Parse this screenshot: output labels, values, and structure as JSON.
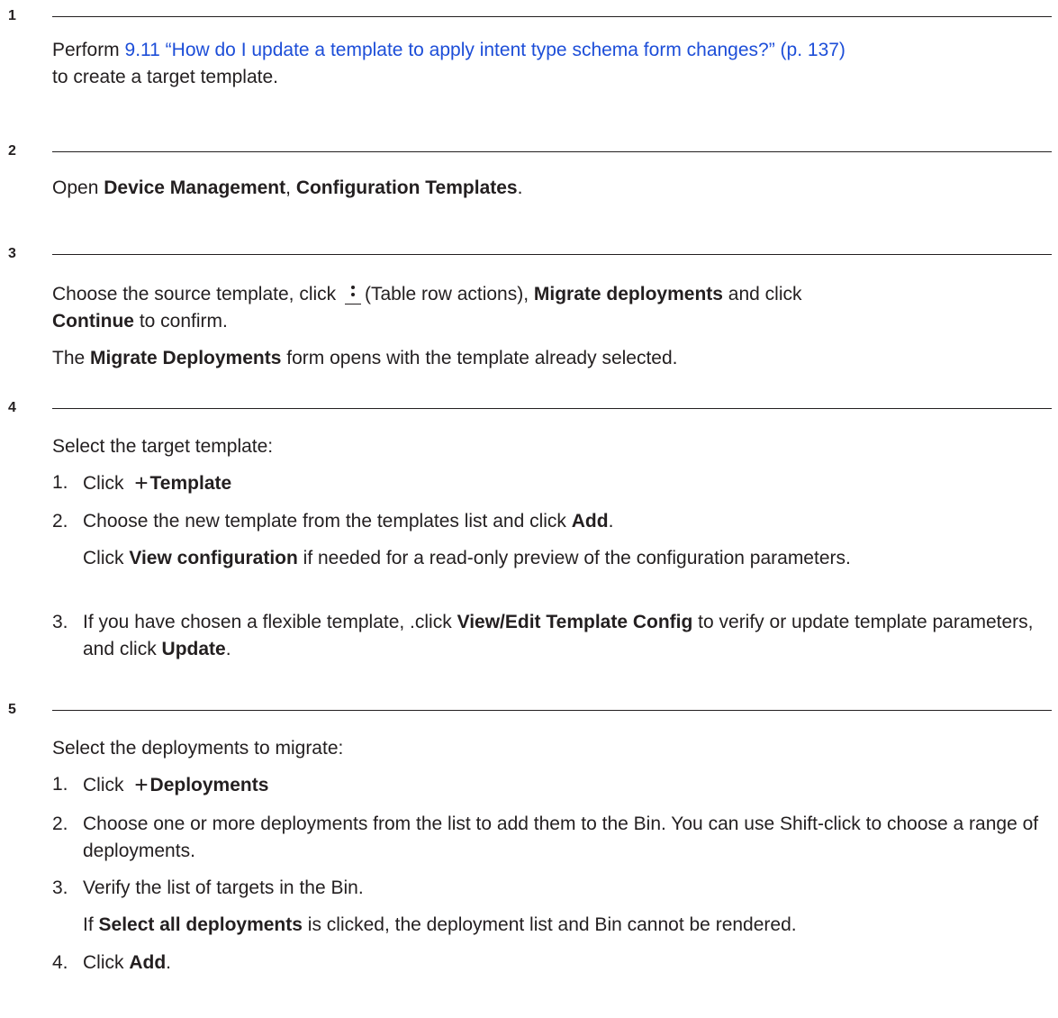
{
  "steps": [
    {
      "number": "1",
      "lines": {
        "prefix": "Perform ",
        "link": "9.11 “How do I update a template to apply intent type schema form changes?” (p. 137)",
        "suffix": "to create a target template."
      }
    },
    {
      "number": "2",
      "text": {
        "open": "Open ",
        "bold1": "Device Management",
        "comma": ", ",
        "bold2": "Configuration Templates",
        "end": "."
      }
    },
    {
      "number": "3",
      "line1": {
        "a": "Choose the source template, click ",
        "b": "(Table row actions), ",
        "bold": "Migrate deployments",
        "c": " and click"
      },
      "line2": {
        "bold": "Continue",
        "rest": " to confirm."
      },
      "line3": {
        "a": "The ",
        "bold": "Migrate Deployments",
        "rest": " form opens with the template already selected."
      },
      "kebab_icon": "more-vertical-icon"
    },
    {
      "number": "4",
      "intro": "Select the target template:",
      "items": [
        {
          "n": "1.",
          "a": "Click ",
          "bold": "Template",
          "rest": ""
        },
        {
          "n": "2.",
          "a": "Choose the new template from the templates list and click ",
          "bold": "Add",
          "rest": "."
        },
        {
          "n": "3.",
          "a": "If you have chosen a flexible template, .click ",
          "bold": "View/Edit Template Config",
          "rest": " to verify or update template parameters, and click ",
          "bold2": "Update",
          "rest2": "."
        }
      ],
      "item2_sub": {
        "a": "Click ",
        "bold": "View configuration",
        "rest": " if needed for a read-only preview of the configuration parameters."
      },
      "plus_icon": "plus-icon",
      "plus_glyph": "+"
    },
    {
      "number": "5",
      "intro": "Select the deployments to migrate:",
      "items": [
        {
          "n": "1.",
          "a": "Click ",
          "bold": "Deployments",
          "rest": ""
        },
        {
          "n": "2.",
          "text": "Choose one or more deployments from the list to add them to the Bin. You can use Shift-click to choose a range of deployments."
        },
        {
          "n": "3.",
          "text": "Verify the list of targets in the Bin."
        },
        {
          "n": "4.",
          "a": "Click ",
          "bold": "Add",
          "rest": "."
        }
      ],
      "item3_sub": {
        "a": "If ",
        "bold": "Select all deployments",
        "rest": " is clicked, the deployment list and Bin cannot be rendered."
      },
      "plus_glyph": "+"
    }
  ]
}
